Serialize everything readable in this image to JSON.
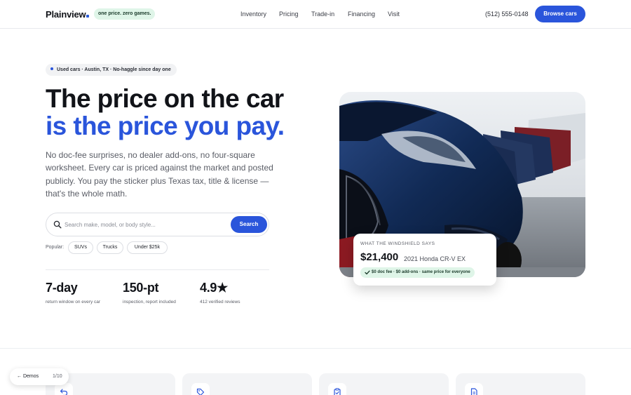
{
  "header": {
    "logo": "Plainview",
    "tagline": "one price. zero games.",
    "nav": [
      "Inventory",
      "Pricing",
      "Trade-in",
      "Financing",
      "Visit"
    ],
    "phone": "(512) 555-0148",
    "cta": "Browse cars"
  },
  "hero": {
    "eyebrow": "Used cars · Austin, TX · No-haggle since day one",
    "headline_line1": "The price on the car",
    "headline_line2": "is the price you pay.",
    "lede": "No doc-fee surprises, no dealer add-ons, no four-square worksheet. Every car is priced against the market and posted publicly. You pay the sticker plus Texas tax, title & license — that's the whole math.",
    "search": {
      "placeholder": "Search make, model, or body style...",
      "value": "",
      "button": "Search"
    },
    "popular_label": "Popular:",
    "popular_chips": [
      "SUVs",
      "Trucks",
      "Under $25k"
    ],
    "stats": [
      {
        "value": "7-day",
        "label": "return window on every car"
      },
      {
        "value": "150-pt",
        "label": "inspection, report included"
      },
      {
        "value": "4.9★",
        "label": "412 verified reviews"
      }
    ]
  },
  "price_card": {
    "eyebrow": "WHAT THE WINDSHIELD SAYS",
    "price": "$21,400",
    "model": "2021 Honda CR-V EX",
    "pill": "$0 doc fee · $0 add-ons · same price for everyone"
  },
  "features": {
    "icons": [
      "return-arrow-icon",
      "price-tag-icon",
      "clipboard-check-icon",
      "document-icon"
    ]
  },
  "demos": {
    "link": "← Demos",
    "count": "1/10"
  },
  "colors": {
    "accent": "#2a55db",
    "mint": "#dff5e8",
    "ink": "#111318",
    "muted": "#5a5d66"
  }
}
